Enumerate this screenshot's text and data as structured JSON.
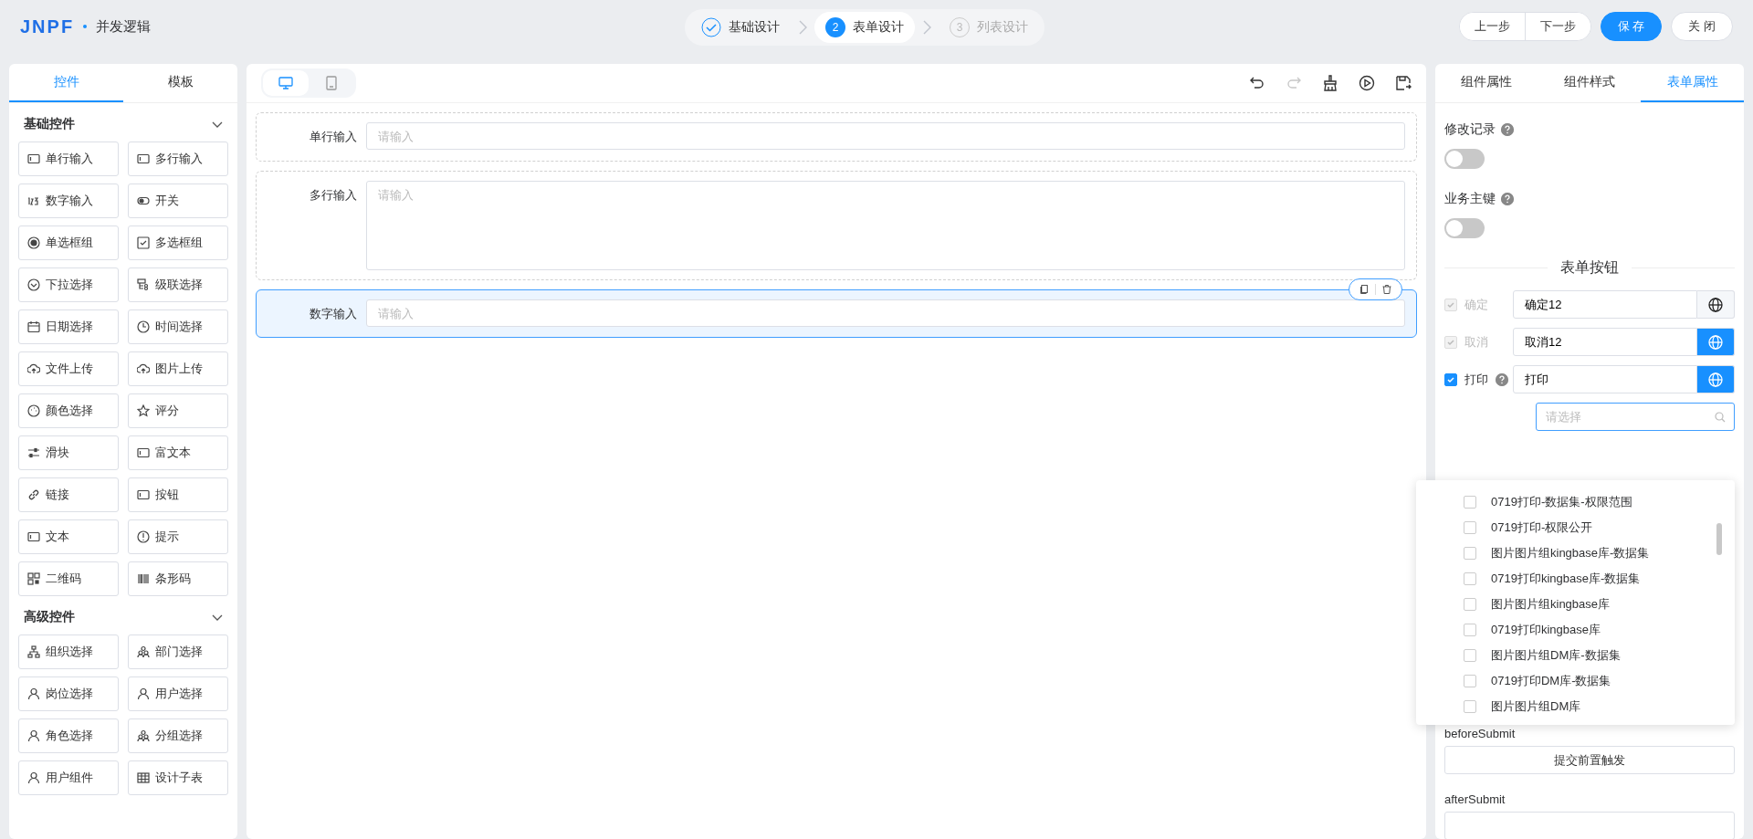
{
  "header": {
    "logo": "JNPF",
    "title": "并发逻辑",
    "steps": [
      {
        "label": "基础设计",
        "completed": true,
        "selected": false
      },
      {
        "number": "2",
        "label": "表单设计",
        "completed": false,
        "selected": true
      },
      {
        "number": "3",
        "label": "列表设计",
        "completed": false,
        "selected": false
      }
    ],
    "actions": [
      {
        "label": "上一步",
        "kind": "group"
      },
      {
        "label": "下一步",
        "kind": "group"
      },
      {
        "label": "保 存",
        "kind": "primary"
      },
      {
        "label": "关 闭",
        "kind": "default"
      }
    ]
  },
  "left_panel": {
    "tabs": [
      {
        "label": "控件",
        "selected": true
      },
      {
        "label": "模板",
        "selected": false
      }
    ],
    "sections": [
      {
        "title": "基础控件",
        "expanded": true,
        "items": [
          "单行输入",
          "多行输入",
          "数字输入",
          "开关",
          "单选框组",
          "多选框组",
          "下拉选择",
          "级联选择",
          "日期选择",
          "时间选择",
          "文件上传",
          "图片上传",
          "颜色选择",
          "评分",
          "滑块",
          "富文本",
          "链接",
          "按钮",
          "文本",
          "提示",
          "二维码",
          "条形码"
        ]
      },
      {
        "title": "高级控件",
        "expanded": true,
        "items": [
          "组织选择",
          "部门选择",
          "岗位选择",
          "用户选择",
          "角色选择",
          "分组选择",
          "用户组件",
          "设计子表"
        ]
      }
    ]
  },
  "canvas": {
    "devices": [
      {
        "kind": "desktop",
        "selected": true
      },
      {
        "kind": "tablet",
        "selected": false
      }
    ],
    "tools": [
      {
        "kind": "undo",
        "disabled": false
      },
      {
        "kind": "redo",
        "disabled": true
      },
      {
        "kind": "clear",
        "disabled": false
      },
      {
        "kind": "preview",
        "disabled": false
      },
      {
        "kind": "export",
        "disabled": false
      }
    ],
    "fields": [
      {
        "label": "单行输入",
        "kind": "input",
        "placeholder": "请输入",
        "selected": false
      },
      {
        "label": "多行输入",
        "kind": "textarea",
        "placeholder": "请输入",
        "selected": false
      },
      {
        "label": "数字输入",
        "kind": "input",
        "placeholder": "请输入",
        "selected": true
      }
    ]
  },
  "right_panel": {
    "tabs": [
      {
        "label": "组件属性",
        "selected": false
      },
      {
        "label": "组件样式",
        "selected": false
      },
      {
        "label": "表单属性",
        "selected": true
      }
    ],
    "switches": [
      {
        "label": "修改记录",
        "on": false
      },
      {
        "label": "业务主键",
        "on": false
      }
    ],
    "buttons_title": "表单按钮",
    "form_buttons": [
      {
        "label": "确定",
        "checked": true,
        "disabled": true,
        "help": false,
        "value": "确定12",
        "translate_active": false
      },
      {
        "label": "取消",
        "checked": true,
        "disabled": true,
        "help": false,
        "value": "取消12",
        "translate_active": true
      },
      {
        "label": "打印",
        "checked": true,
        "disabled": false,
        "help": true,
        "value": "打印",
        "translate_active": true
      }
    ],
    "print_select": {
      "placeholder": "请选择"
    },
    "print_options": [
      {
        "label": "0719打印-数据集-权限范围",
        "checked": false
      },
      {
        "label": "0719打印-权限公开",
        "checked": false
      },
      {
        "label": "图片图片组kingbase库-数据集",
        "checked": false
      },
      {
        "label": "0719打印kingbase库-数据集",
        "checked": false
      },
      {
        "label": "图片图片组kingbase库",
        "checked": false
      },
      {
        "label": "0719打印kingbase库",
        "checked": false
      },
      {
        "label": "图片图片组DM库-数据集",
        "checked": false
      },
      {
        "label": "0719打印DM库-数据集",
        "checked": false
      },
      {
        "label": "图片图片组DM库",
        "checked": false
      }
    ],
    "events": [
      {
        "label": "beforeSubmit",
        "button": "提交前置触发"
      },
      {
        "label": "afterSubmit"
      }
    ]
  }
}
